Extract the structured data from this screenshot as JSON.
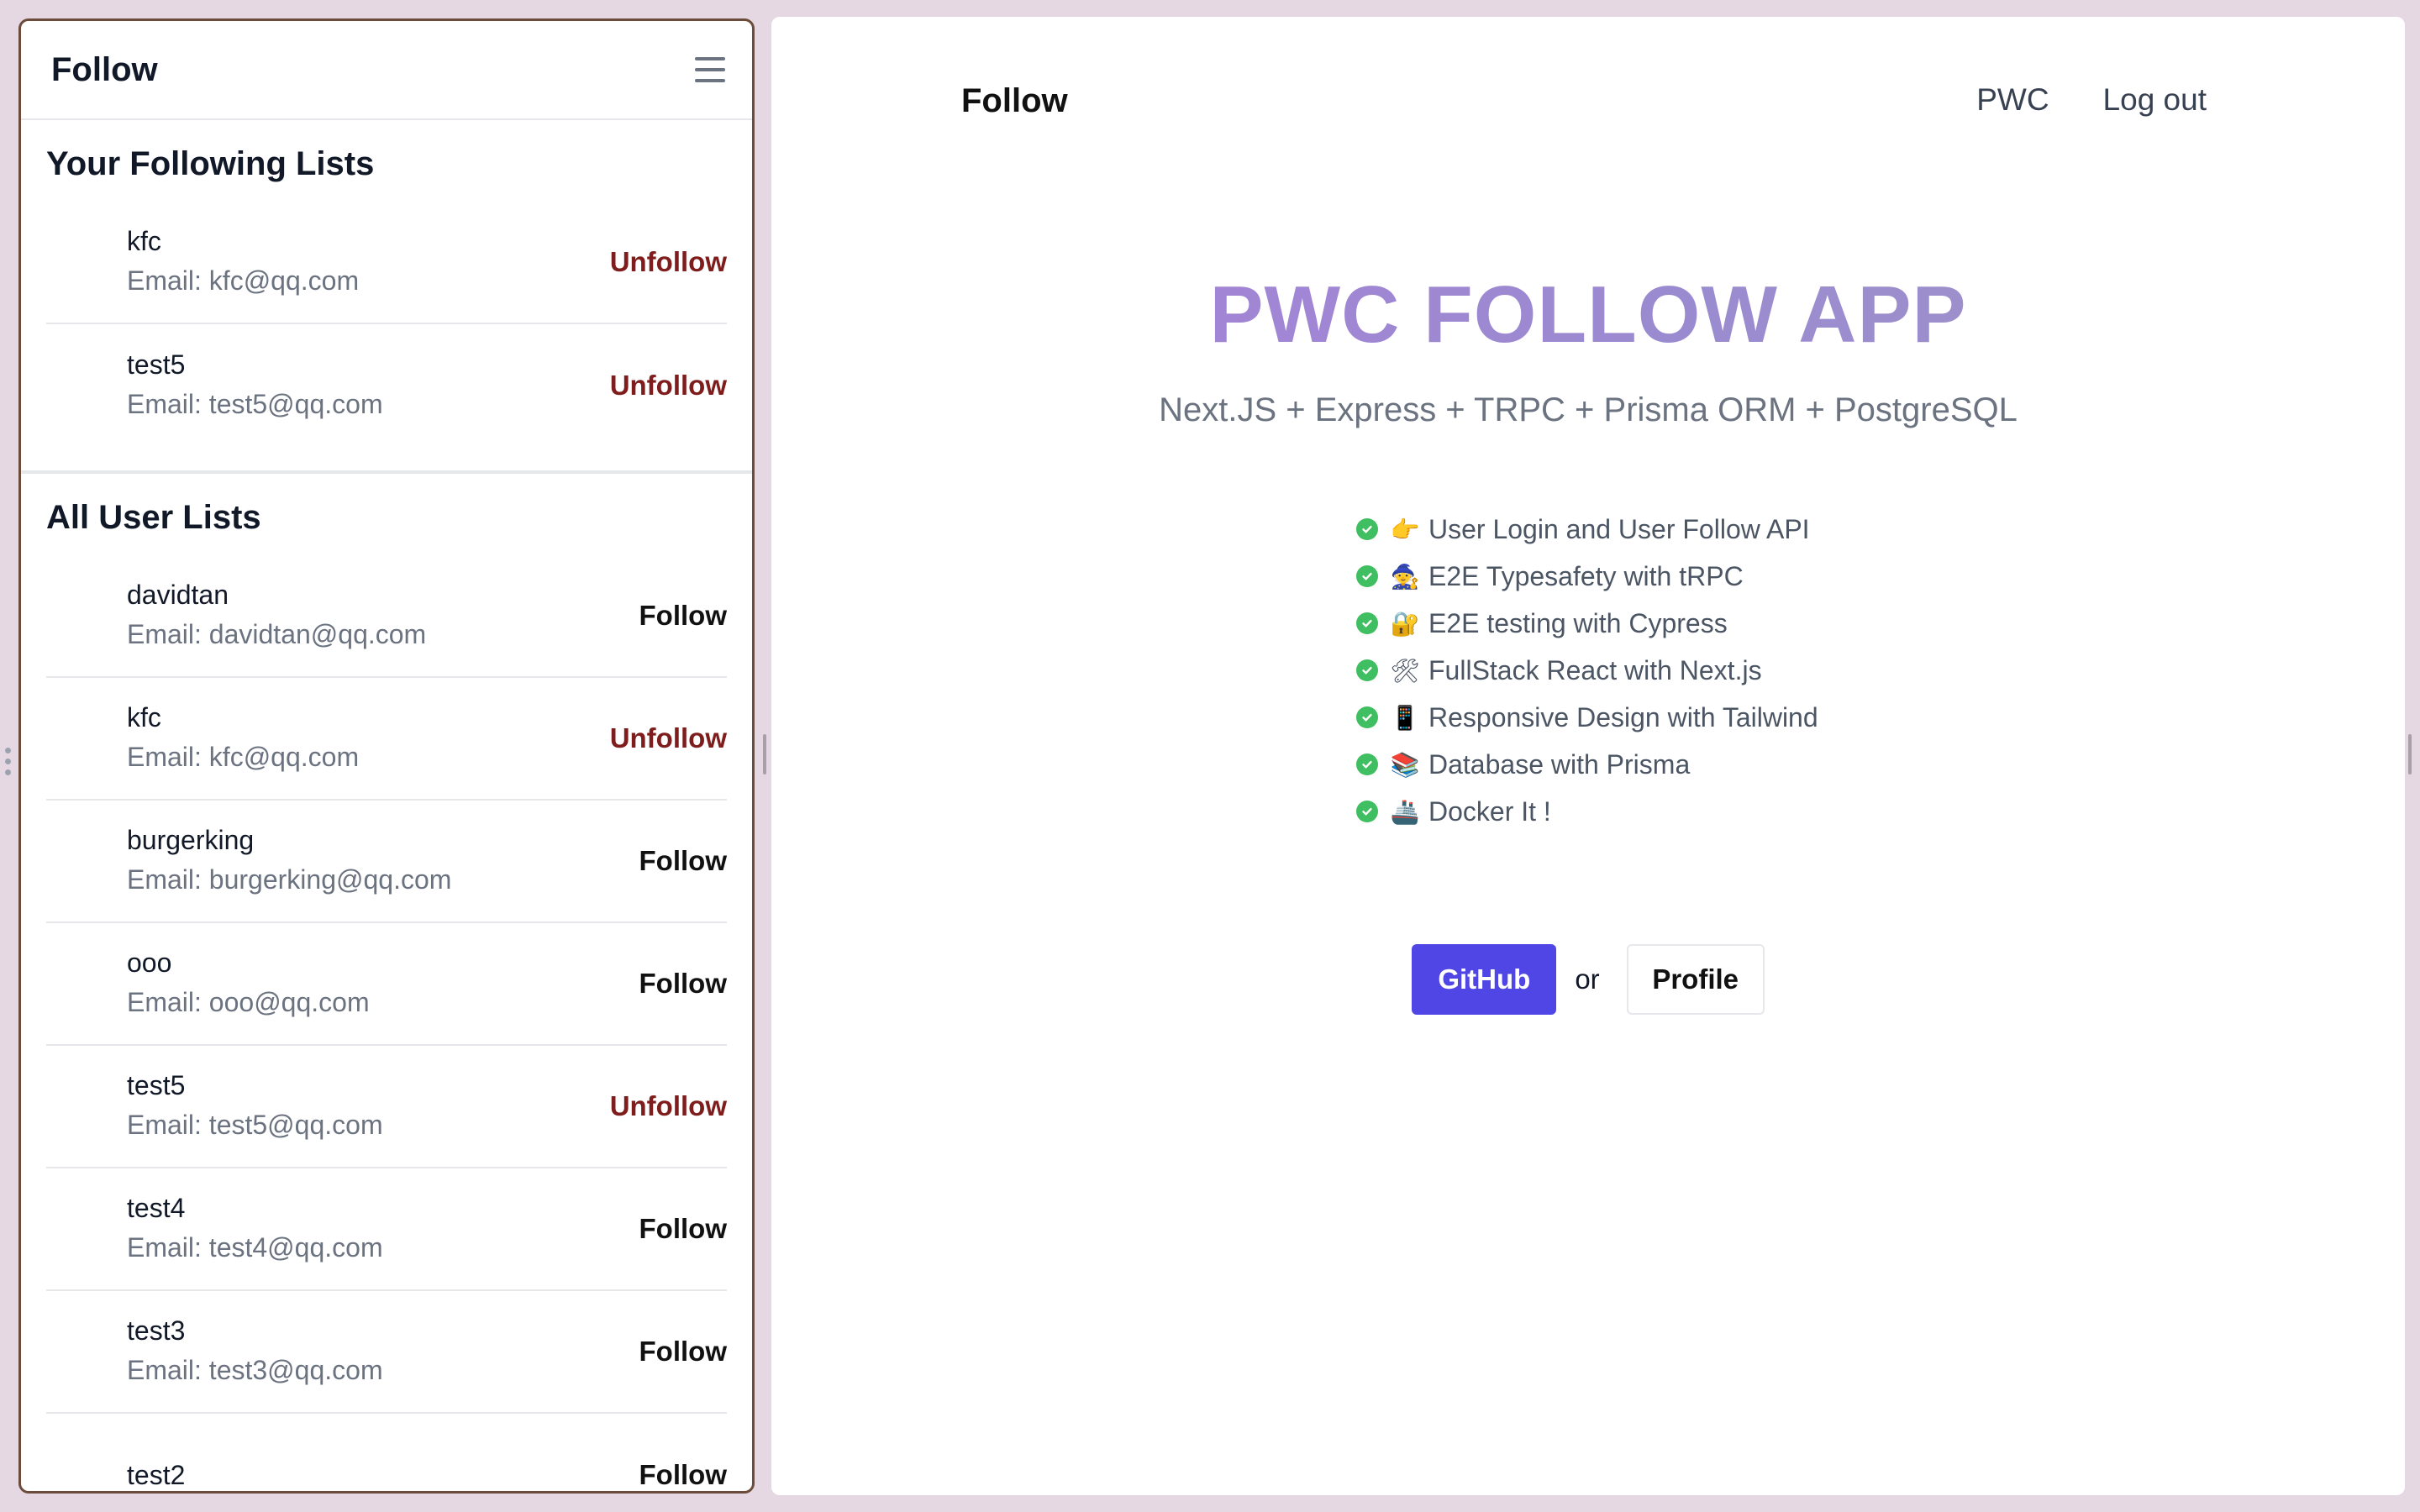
{
  "sidebar": {
    "title": "Follow",
    "following": {
      "title": "Your Following Lists",
      "users": [
        {
          "name": "kfc",
          "email": "Email: kfc@qq.com",
          "action": "Unfollow"
        },
        {
          "name": "test5",
          "email": "Email: test5@qq.com",
          "action": "Unfollow"
        }
      ]
    },
    "all": {
      "title": "All User Lists",
      "users": [
        {
          "name": "davidtan",
          "email": "Email: davidtan@qq.com",
          "action": "Follow"
        },
        {
          "name": "kfc",
          "email": "Email: kfc@qq.com",
          "action": "Unfollow"
        },
        {
          "name": "burgerking",
          "email": "Email: burgerking@qq.com",
          "action": "Follow"
        },
        {
          "name": "ooo",
          "email": "Email: ooo@qq.com",
          "action": "Follow"
        },
        {
          "name": "test5",
          "email": "Email: test5@qq.com",
          "action": "Unfollow"
        },
        {
          "name": "test4",
          "email": "Email: test4@qq.com",
          "action": "Follow"
        },
        {
          "name": "test3",
          "email": "Email: test3@qq.com",
          "action": "Follow"
        },
        {
          "name": "test2",
          "email": "",
          "action": "Follow"
        }
      ]
    }
  },
  "navbar": {
    "brand": "Follow",
    "links": [
      "PWC",
      "Log out"
    ]
  },
  "hero": {
    "title": "PWC FOLLOW APP",
    "subtitle": "Next.JS + Express + TRPC + Prisma ORM + PostgreSQL"
  },
  "features": [
    {
      "emoji": "👉",
      "text": "User Login and User Follow API"
    },
    {
      "emoji": "🧙",
      "text": "E2E Typesafety with tRPC"
    },
    {
      "emoji": "🔐",
      "text": "E2E testing with Cypress"
    },
    {
      "emoji": "🛠",
      "text": "FullStack React with Next.js"
    },
    {
      "emoji": "📱",
      "text": "Responsive Design with Tailwind"
    },
    {
      "emoji": "📚",
      "text": "Database with Prisma"
    },
    {
      "emoji": "🚢",
      "text": "Docker It !"
    }
  ],
  "cta": {
    "primary": "GitHub",
    "separator": "or",
    "secondary": "Profile"
  },
  "colors": {
    "background": "#e6d8e3",
    "unfollow": "#7f1d1d",
    "primary_button": "#4f46e5",
    "check": "#3fbf62"
  }
}
